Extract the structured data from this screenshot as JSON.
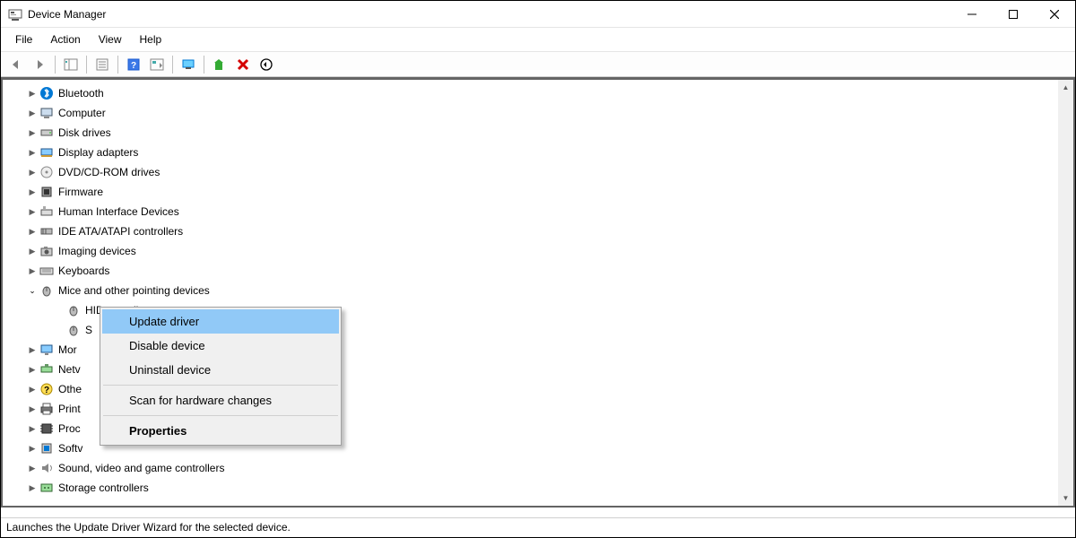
{
  "window": {
    "title": "Device Manager"
  },
  "menu": {
    "file": "File",
    "action": "Action",
    "view": "View",
    "help": "Help"
  },
  "tree": {
    "bluetooth": "Bluetooth",
    "computer": "Computer",
    "disk": "Disk drives",
    "display": "Display adapters",
    "dvd": "DVD/CD-ROM drives",
    "firmware": "Firmware",
    "hid": "Human Interface Devices",
    "ide": "IDE ATA/ATAPI controllers",
    "imaging": "Imaging devices",
    "keyboards": "Keyboards",
    "mice": "Mice and other pointing devices",
    "mice_child1": "HID-compliant mouse",
    "mice_child2": "S",
    "monitors_partial": "Mor",
    "network_partial": "Netv",
    "other_partial": "Othe",
    "print_partial": "Print",
    "processors_partial": "Proc",
    "software_partial": "Softv",
    "sound": "Sound, video and game controllers",
    "storage": "Storage controllers"
  },
  "context": {
    "update": "Update driver",
    "disable": "Disable device",
    "uninstall": "Uninstall device",
    "scan": "Scan for hardware changes",
    "properties": "Properties"
  },
  "status": "Launches the Update Driver Wizard for the selected device."
}
